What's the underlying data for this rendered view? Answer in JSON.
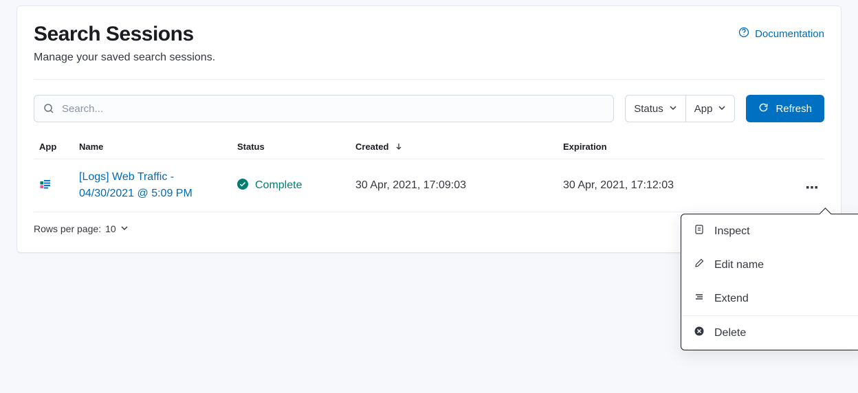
{
  "header": {
    "title": "Search Sessions",
    "subtitle": "Manage your saved search sessions.",
    "doc_link": "Documentation"
  },
  "controls": {
    "search_placeholder": "Search...",
    "filter_status": "Status",
    "filter_app": "App",
    "refresh": "Refresh"
  },
  "table": {
    "columns": {
      "app": "App",
      "name": "Name",
      "status": "Status",
      "created": "Created",
      "expiration": "Expiration"
    },
    "rows": [
      {
        "name": "[Logs] Web Traffic - 04/30/2021 @ 5:09 PM",
        "status": "Complete",
        "created": "30 Apr, 2021, 17:09:03",
        "expiration": "30 Apr, 2021, 17:12:03"
      }
    ]
  },
  "footer": {
    "rows_per_page_label": "Rows per page:",
    "rows_per_page_value": "10"
  },
  "popover": {
    "inspect": "Inspect",
    "edit_name": "Edit name",
    "extend": "Extend",
    "delete": "Delete"
  }
}
